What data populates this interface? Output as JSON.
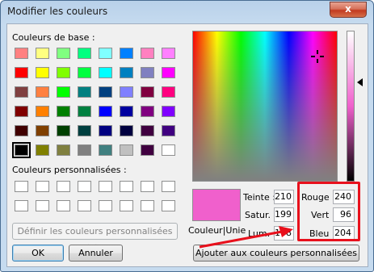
{
  "window": {
    "title": "Modifier les couleurs",
    "close_label": "x"
  },
  "basic_colors": {
    "label": "Couleurs de base :",
    "swatches": [
      "#ff8080",
      "#ffff80",
      "#80ff80",
      "#00ff80",
      "#80ffff",
      "#0080ff",
      "#ff80c0",
      "#ff80ff",
      "#ff0000",
      "#ffff00",
      "#80ff00",
      "#00ff40",
      "#00ffff",
      "#0080c0",
      "#8080c0",
      "#ff00ff",
      "#804040",
      "#ff8040",
      "#00ff00",
      "#008080",
      "#004080",
      "#8080ff",
      "#800040",
      "#ff0080",
      "#800000",
      "#ff8000",
      "#008000",
      "#008040",
      "#0000ff",
      "#0000a0",
      "#800080",
      "#8000ff",
      "#400000",
      "#804000",
      "#004000",
      "#004040",
      "#000080",
      "#000040",
      "#400040",
      "#400080",
      "#000000",
      "#808000",
      "#808040",
      "#808080",
      "#408080",
      "#c0c0c0",
      "#400040",
      "#ffffff"
    ],
    "selected_index": 40
  },
  "custom_colors": {
    "label": "Couleurs personnalisées :"
  },
  "buttons": {
    "define_custom": "Définir les couleurs personnalisées >>",
    "ok": "OK",
    "cancel": "Annuler",
    "add_custom": "Ajouter aux couleurs personnalisées"
  },
  "preview": {
    "color": "#f060cc",
    "label": "Couleur|Unie"
  },
  "fields": {
    "hue": {
      "label": "Teinte :",
      "value": "210"
    },
    "sat": {
      "label": "Satur. :",
      "value": "199"
    },
    "lum": {
      "label": "Lum. :",
      "value": "108"
    },
    "red": {
      "label": "Rouge :",
      "value": "240"
    },
    "green": {
      "label": "Vert :",
      "value": "96"
    },
    "blue": {
      "label": "Bleu :",
      "value": "204"
    }
  },
  "colors": {
    "annotation_red": "#e8101c",
    "accent": "#3c7fb1"
  }
}
